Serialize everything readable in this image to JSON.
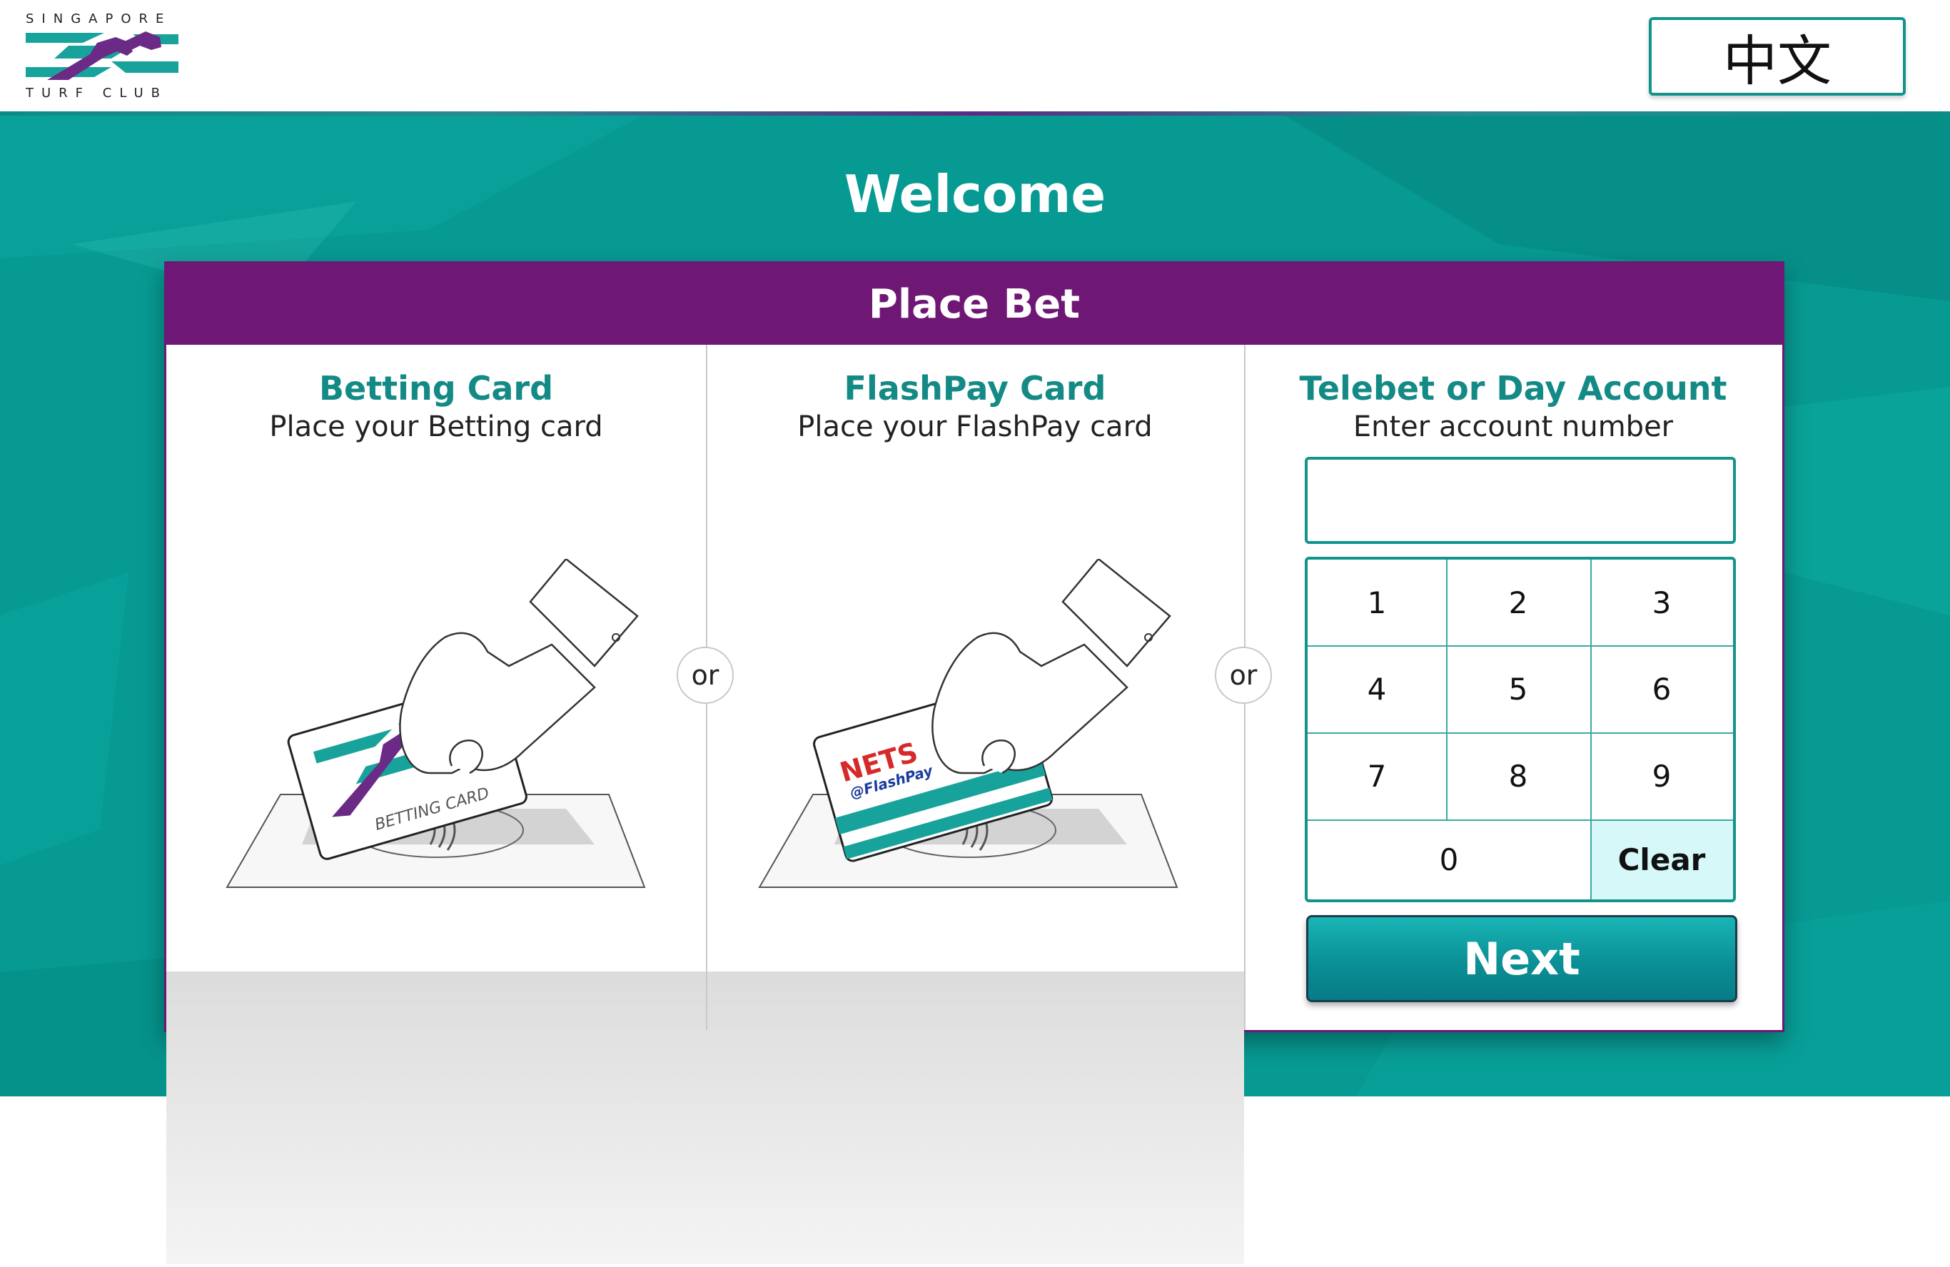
{
  "header": {
    "logo_top_text": "SINGAPORE",
    "logo_bottom_text": "TURF CLUB",
    "language_button_label": "中文"
  },
  "main": {
    "welcome_text": "Welcome",
    "panel_title": "Place Bet",
    "or_label": "or"
  },
  "betting_card": {
    "title": "Betting Card",
    "subtitle": "Place your Betting card",
    "card_text": "BETTING CARD"
  },
  "flashpay_card": {
    "title": "FlashPay Card",
    "subtitle": "Place your FlashPay card",
    "card_brand": "NETS",
    "card_sub": "@FlashPay"
  },
  "account": {
    "title": "Telebet or Day Account",
    "subtitle": "Enter account number",
    "input_value": ""
  },
  "keypad": {
    "keys": [
      "1",
      "2",
      "3",
      "4",
      "5",
      "6",
      "7",
      "8",
      "9"
    ],
    "zero": "0",
    "clear": "Clear"
  },
  "next_label": "Next",
  "colors": {
    "teal": "#079a93",
    "purple": "#6e1774",
    "accent_text": "#138a86",
    "clear_key": "#d6f8f8"
  }
}
